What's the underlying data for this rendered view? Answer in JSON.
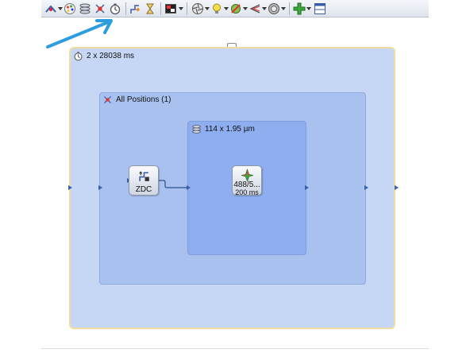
{
  "toolbar": {
    "icons": [
      "acquisition-mode-icon",
      "color-palette-icon",
      "z-stack-icon",
      "multi-position-icon",
      "time-lapse-icon",
      "autofocus-icon",
      "wait-icon",
      "channel-icon",
      "shutter-icon",
      "light-source-icon",
      "filter-icon",
      "laser-icon",
      "phase-icon",
      "add-icon",
      "layout-icon"
    ]
  },
  "experiment": {
    "time_block_label": "2 x 28038 ms",
    "position_block_label": "All Positions (1)",
    "zstack_block_label": "114 x 1.95 µm",
    "zdc_node_label": "ZDC",
    "channel_node_line1": "488/5...",
    "channel_node_line2": "200 ms"
  },
  "colors": {
    "annotation_arrow": "#2d9de0",
    "outer_block": "#c6d7f6",
    "outer_border": "#f1dca0",
    "position_block": "#a9c1ef",
    "zstack_block": "#8eaef0"
  }
}
